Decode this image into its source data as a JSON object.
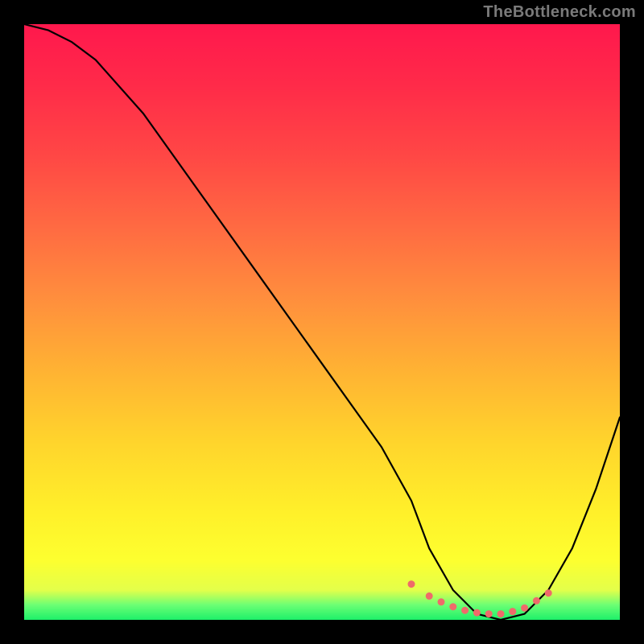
{
  "watermark": "TheBottleneck.com",
  "chart_data": {
    "type": "line",
    "title": "",
    "xlabel": "",
    "ylabel": "",
    "xlim": [
      0,
      100
    ],
    "ylim": [
      0,
      100
    ],
    "gradient_background": {
      "direction": "vertical",
      "stops": [
        {
          "pos": 0,
          "color": "#ff184d"
        },
        {
          "pos": 22,
          "color": "#ff4745"
        },
        {
          "pos": 46,
          "color": "#ff8e3d"
        },
        {
          "pos": 70,
          "color": "#ffd42c"
        },
        {
          "pos": 90,
          "color": "#fdff2f"
        },
        {
          "pos": 97,
          "color": "#6cff74"
        },
        {
          "pos": 100,
          "color": "#1df06a"
        }
      ]
    },
    "series": [
      {
        "name": "bottleneck-curve",
        "color": "#000000",
        "x": [
          0,
          4,
          8,
          12,
          20,
          30,
          40,
          50,
          60,
          65,
          68,
          72,
          76,
          80,
          84,
          88,
          92,
          96,
          100
        ],
        "y": [
          100,
          99,
          97,
          94,
          85,
          71,
          57,
          43,
          29,
          20,
          12,
          5,
          1,
          0,
          1,
          5,
          12,
          22,
          34
        ]
      }
    ],
    "marker_points": {
      "name": "valley-dots",
      "color": "#ef6a6a",
      "radius": 4.5,
      "x": [
        65,
        68,
        70,
        72,
        74,
        76,
        78,
        80,
        82,
        84,
        86,
        88
      ],
      "y": [
        6,
        4,
        3,
        2.2,
        1.6,
        1.2,
        1.0,
        1.0,
        1.4,
        2.0,
        3.2,
        4.5
      ]
    }
  }
}
